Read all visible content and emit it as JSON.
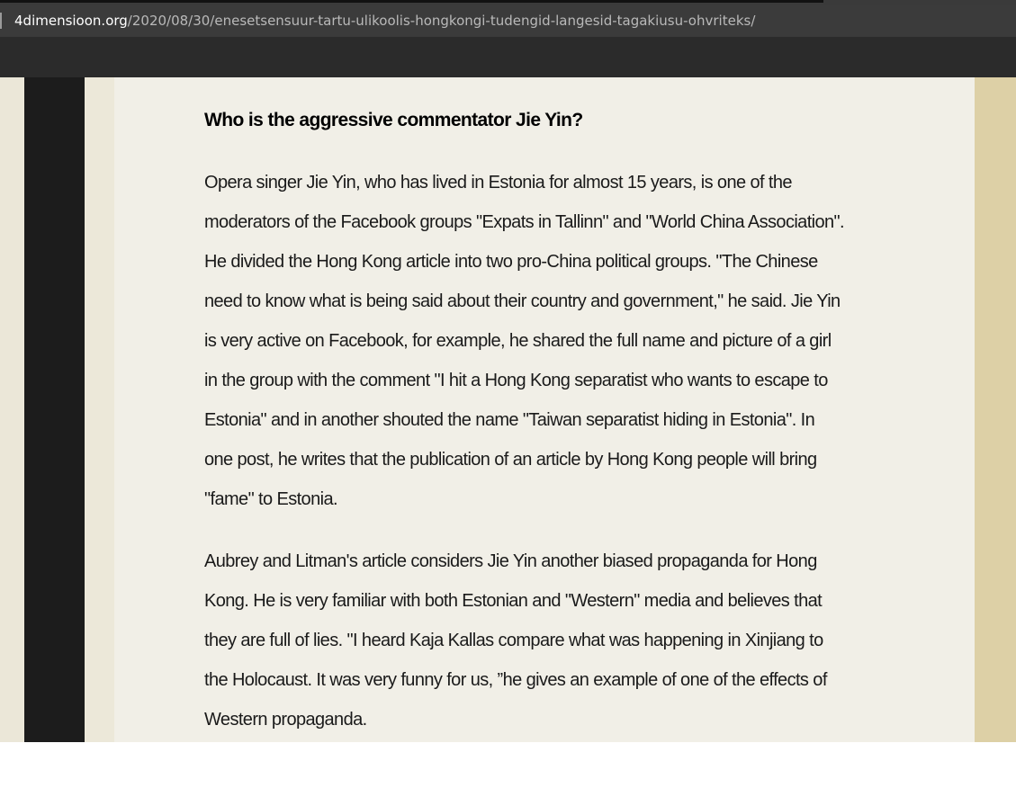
{
  "browser": {
    "url_domain": "4dimensioon.org",
    "url_path": "/2020/08/30/enesetsensuur-tartu-ulikoolis-hongkongi-tudengid-langesid-tagakiusu-ohvriteks/"
  },
  "article": {
    "heading": "Who is the aggressive commentator Jie Yin?",
    "paragraphs": [
      {
        "lines": [
          "Opera singer Jie Yin, who has lived in Estonia for almost 15 years, is one of the",
          "moderators of the Facebook groups \"Expats in Tallinn\" and \"World China Association\".",
          "He divided the Hong Kong article into two pro-China political groups. \"The Chinese",
          "need to know what is being said about their country and government,\" he said. Jie Yin",
          "is very active on Facebook, for example, he shared the full name and picture of a girl",
          "in the group with the comment \"I hit a Hong Kong separatist who wants to escape to",
          "Estonia\" and in another shouted the name \"Taiwan separatist hiding in Estonia\". In",
          "one post, he writes that the publication of an article by Hong Kong people will bring",
          "\"fame\" to Estonia."
        ]
      },
      {
        "lines": [
          "Aubrey and Litman's article considers Jie Yin another biased propaganda for Hong",
          "Kong. He is very familiar with both Estonian and \"Western\" media and believes that",
          "they are full of lies. \"I heard Kaja Kallas compare what was happening in Xinjiang to",
          "the Holocaust. It was very funny for us, ”he gives an example of one of the effects of",
          "Western propaganda."
        ]
      }
    ]
  }
}
